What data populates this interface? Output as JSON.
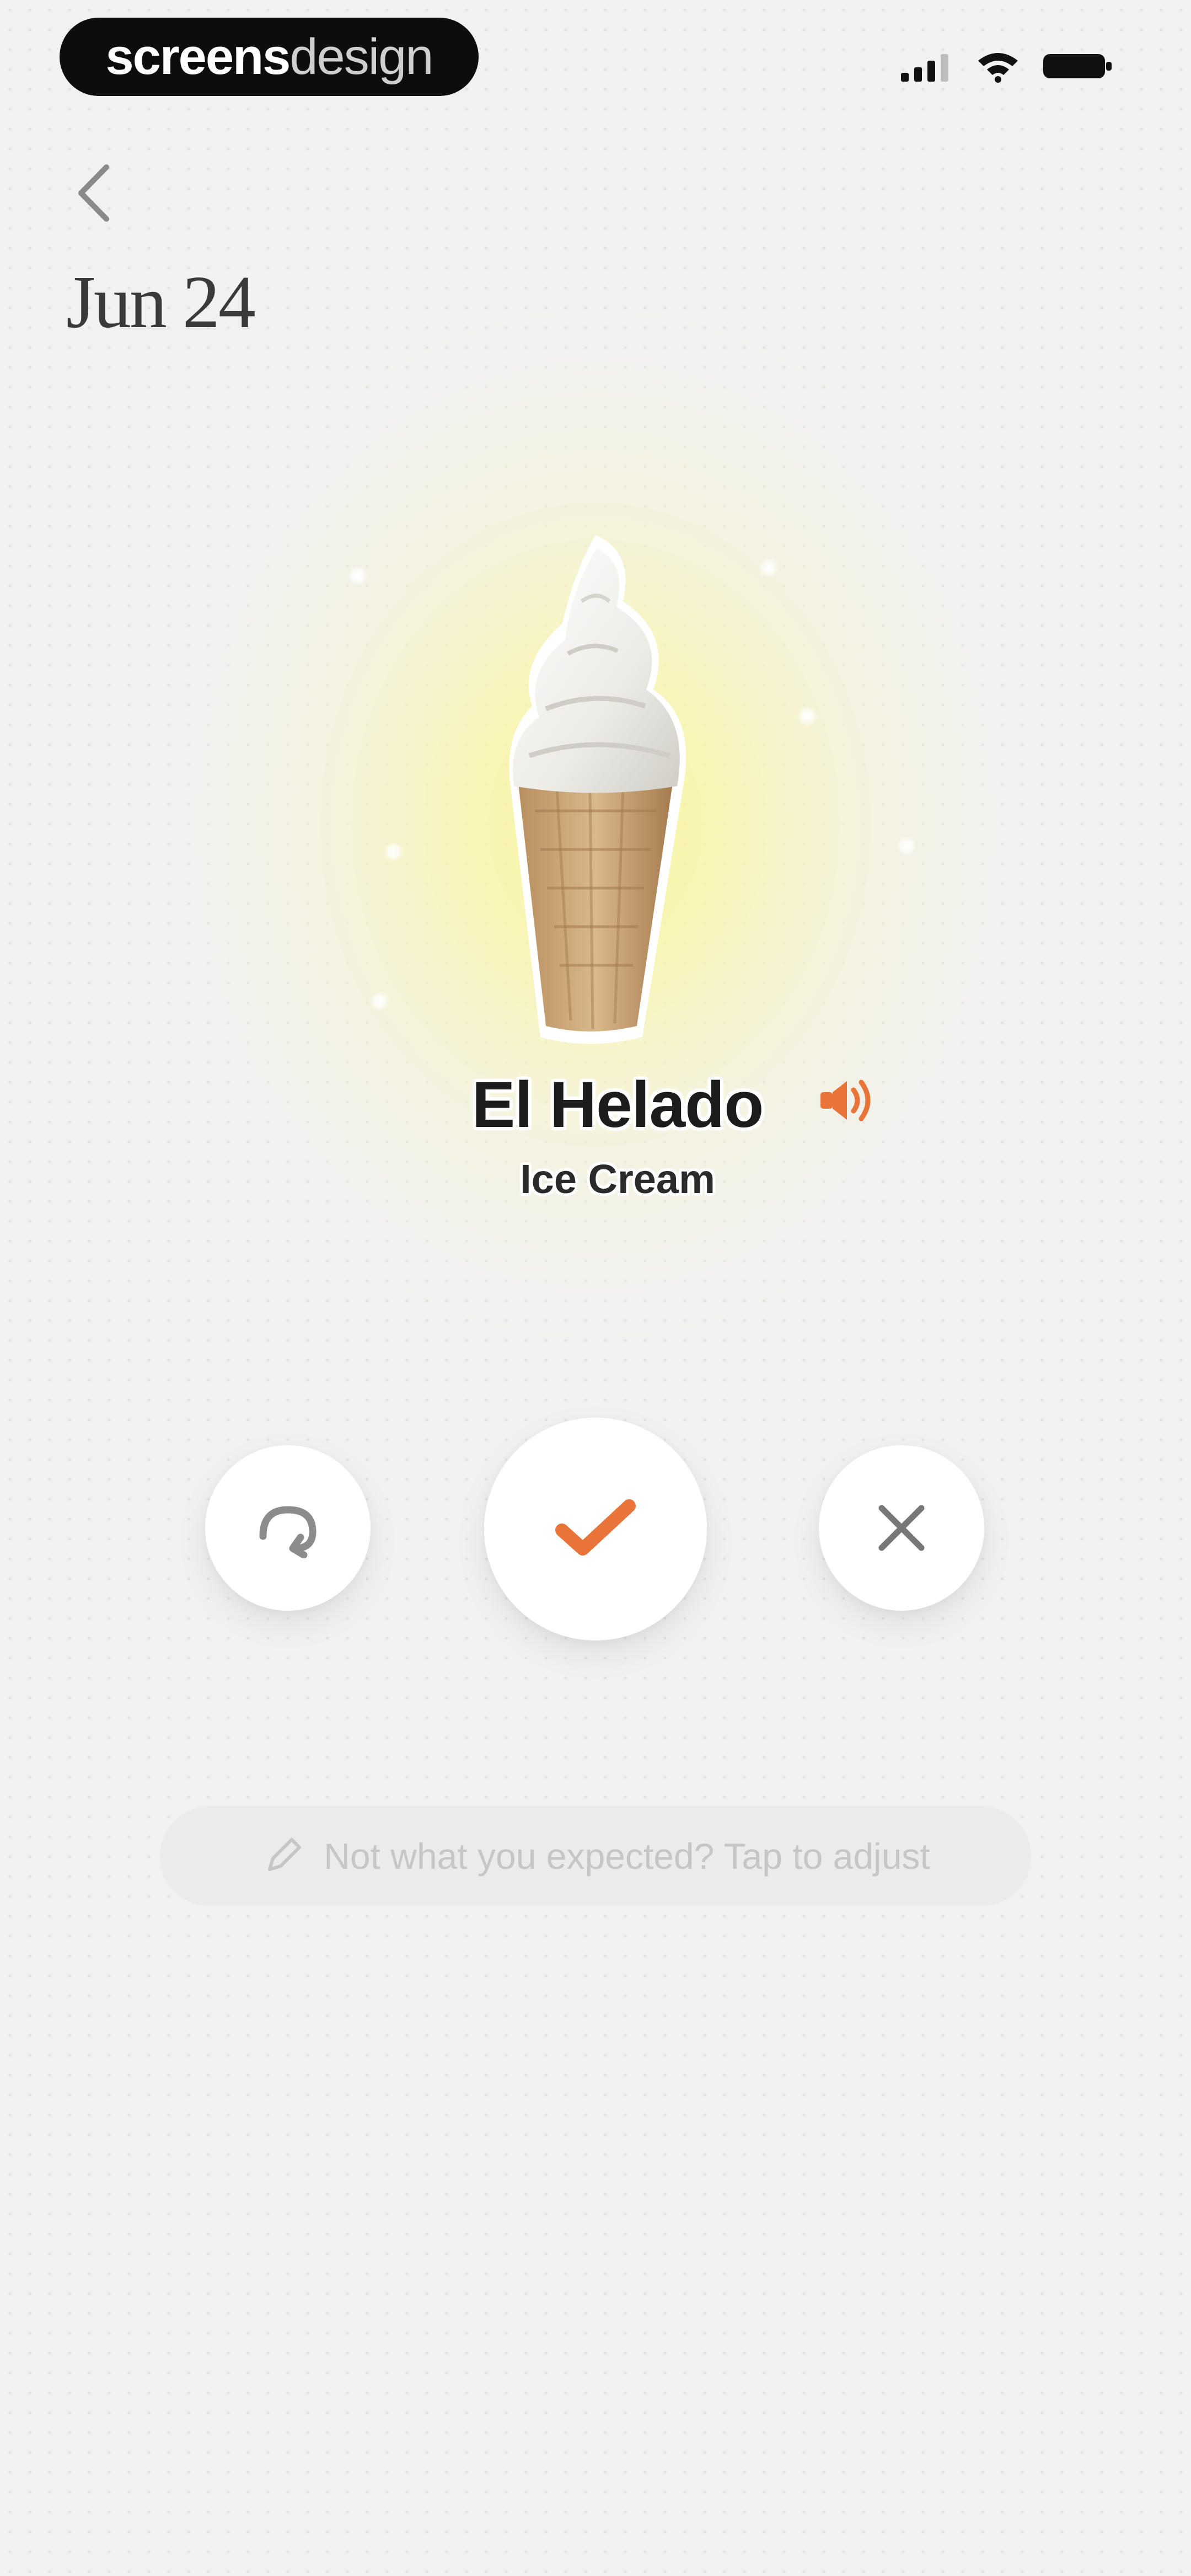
{
  "status_bar": {
    "brand_bold": "screens",
    "brand_light": "design",
    "icons": [
      "cellular-signal-icon",
      "wifi-icon",
      "battery-icon"
    ]
  },
  "header": {
    "back_icon": "chevron-left-icon",
    "date": "Jun 24"
  },
  "card": {
    "image": "ice-cream-cone",
    "word": "El Helado",
    "translation": "Ice Cream",
    "audio_icon": "speaker-icon"
  },
  "actions": {
    "skip_icon": "redo-arrow-icon",
    "confirm_icon": "checkmark-icon",
    "dismiss_icon": "close-icon"
  },
  "adjust": {
    "icon": "pencil-icon",
    "label": "Not what you expected? Tap to adjust"
  },
  "colors": {
    "background": "#f1f1f1",
    "accent": "#e8743a",
    "glow": "#faf596",
    "text_dark": "#1c1c1c",
    "muted_text": "#c6c6c6"
  }
}
